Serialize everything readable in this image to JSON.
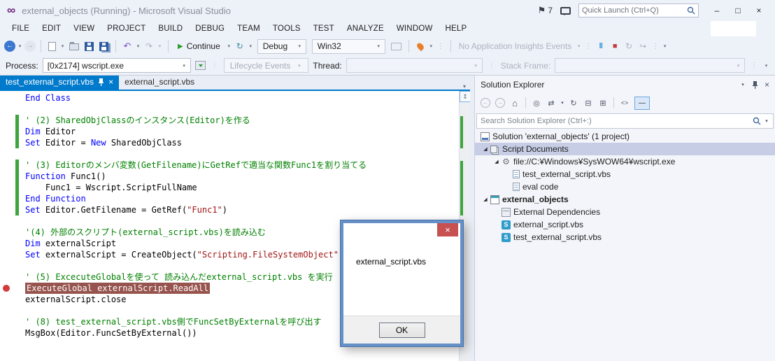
{
  "titlebar": {
    "title": "external_objects (Running) - Microsoft Visual Studio",
    "flag_count": "7",
    "quick_launch_placeholder": "Quick Launch (Ctrl+Q)"
  },
  "menu": [
    "FILE",
    "EDIT",
    "VIEW",
    "PROJECT",
    "BUILD",
    "DEBUG",
    "TEAM",
    "TOOLS",
    "TEST",
    "ANALYZE",
    "WINDOW",
    "HELP"
  ],
  "toolbar": {
    "continue_label": "Continue",
    "debug_config": "Debug",
    "platform": "Win32",
    "insights_label": "No Application Insights Events"
  },
  "process_bar": {
    "process_label": "Process:",
    "process_value": "[0x2174] wscript.exe",
    "lifecycle_label": "Lifecycle Events",
    "thread_label": "Thread:",
    "stack_frame_label": "Stack Frame:"
  },
  "tabs": [
    {
      "label": "test_external_script.vbs",
      "active": true
    },
    {
      "label": "external_script.vbs",
      "active": false
    }
  ],
  "editor": {
    "lines": [
      {
        "seg": [
          {
            "t": "End Class",
            "c": "kw"
          }
        ]
      },
      {
        "seg": []
      },
      {
        "seg": [
          {
            "t": "' (2) SharedObjClassのインスタンス(Editor)を作る",
            "c": "cm"
          }
        ],
        "changed": true
      },
      {
        "seg": [
          {
            "t": "Dim",
            "c": "kw"
          },
          {
            "t": " Editor",
            "c": "id"
          }
        ],
        "changed": true
      },
      {
        "seg": [
          {
            "t": "Set",
            "c": "kw"
          },
          {
            "t": " Editor = ",
            "c": "id"
          },
          {
            "t": "New",
            "c": "kw"
          },
          {
            "t": " SharedObjClass",
            "c": "id"
          }
        ],
        "changed": true
      },
      {
        "seg": []
      },
      {
        "seg": [
          {
            "t": "' (3) Editorのメンバ変数(GetFilename)にGetRefで適当な関数Func1を割り当てる",
            "c": "cm"
          }
        ],
        "changed": true
      },
      {
        "seg": [
          {
            "t": "Function",
            "c": "kw"
          },
          {
            "t": " Func1()",
            "c": "id"
          }
        ],
        "changed": true
      },
      {
        "seg": [
          {
            "t": "    Func1 = Wscript.ScriptFullName",
            "c": "id"
          }
        ],
        "changed": true
      },
      {
        "seg": [
          {
            "t": "End Function",
            "c": "kw"
          }
        ],
        "changed": true
      },
      {
        "seg": [
          {
            "t": "Set",
            "c": "kw"
          },
          {
            "t": " Editor.GetFilename = GetRef(",
            "c": "id"
          },
          {
            "t": "\"Func1\"",
            "c": "str"
          },
          {
            "t": ")",
            "c": "id"
          }
        ],
        "changed": true
      },
      {
        "seg": []
      },
      {
        "seg": [
          {
            "t": "'(4) 外部のスクリプト(external_script.vbs)を読み込む",
            "c": "cm"
          }
        ]
      },
      {
        "seg": [
          {
            "t": "Dim",
            "c": "kw"
          },
          {
            "t": " externalScript",
            "c": "id"
          }
        ]
      },
      {
        "seg": [
          {
            "t": "Set",
            "c": "kw"
          },
          {
            "t": " externalScript = CreateObject(",
            "c": "id"
          },
          {
            "t": "\"Scripting.FileSystemObject\"",
            "c": "str"
          },
          {
            "t": ")",
            "c": "id"
          }
        ]
      },
      {
        "seg": []
      },
      {
        "seg": [
          {
            "t": "' (5) ExcecuteGlobalを使って 読み込んだexternal_script.vbs を実行",
            "c": "cm"
          }
        ]
      },
      {
        "seg": [
          {
            "t": "ExecuteGlobal externalScript.ReadAll",
            "c": "id"
          }
        ],
        "breakpoint": true,
        "highlight": true
      },
      {
        "seg": [
          {
            "t": "externalScript.close",
            "c": "id"
          }
        ]
      },
      {
        "seg": []
      },
      {
        "seg": [
          {
            "t": "' (8) test_external_script.vbs側でFuncSetByExternalを呼び出す",
            "c": "cm"
          }
        ]
      },
      {
        "seg": [
          {
            "t": "MsgBox(Editor.FuncSetByExternal())",
            "c": "id"
          }
        ]
      }
    ]
  },
  "dialog": {
    "message": "external_script.vbs",
    "ok_label": "OK"
  },
  "solution_explorer": {
    "title": "Solution Explorer",
    "search_placeholder": "Search Solution Explorer (Ctrl+:)",
    "tree": [
      {
        "label": "Solution 'external_objects' (1 project)",
        "indent": 0,
        "slot": false,
        "icon": "solution-icon"
      },
      {
        "label": "Script Documents",
        "indent": 0,
        "expander": true,
        "icon": "script-documents-icon",
        "selected": true
      },
      {
        "label": "file://C:¥Windows¥SysWOW64¥wscript.exe",
        "indent": 1,
        "expander": true,
        "icon": "exe-icon"
      },
      {
        "label": "test_external_script.vbs",
        "indent": 2,
        "icon": "doc-icon"
      },
      {
        "label": "eval code",
        "indent": 2,
        "icon": "doc-icon"
      },
      {
        "label": "external_objects",
        "indent": 0,
        "expander": true,
        "icon": "project-icon",
        "bold": true
      },
      {
        "label": "External Dependencies",
        "indent": 1,
        "icon": "dependencies-icon"
      },
      {
        "label": "external_script.vbs",
        "indent": 1,
        "icon": "vbs-icon"
      },
      {
        "label": "test_external_script.vbs",
        "indent": 1,
        "icon": "vbs-icon"
      }
    ]
  },
  "icons": {
    "caret": "▾",
    "close": "×",
    "minimize": "–",
    "maximize": "□",
    "flag": "⚑",
    "back-arrow": "←",
    "forward-arrow": "→",
    "home": "⌂",
    "scope": "◎",
    "sync": "⇄",
    "refresh": "↻",
    "collapse-all": "⊟",
    "show-all-files": "⊞",
    "code-view": "<>",
    "preview-toggle": "—",
    "undo": "↶",
    "redo": "↷",
    "play": "▶",
    "pause": "‖",
    "stop": "■",
    "step": "↪",
    "grip": "⋮",
    "split": "⇕",
    "expander-expanded": "◢"
  }
}
